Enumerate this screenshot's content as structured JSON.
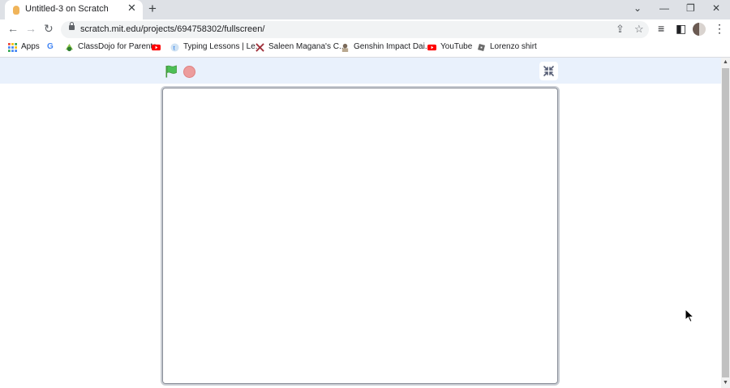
{
  "browser": {
    "tab": {
      "title": "Untitled-3 on Scratch",
      "close_glyph": "✕"
    },
    "new_tab_glyph": "+",
    "window_controls": {
      "dropdown": "⌄",
      "minimize": "—",
      "restore": "❐",
      "close": "✕"
    },
    "nav": {
      "back": "←",
      "forward": "→",
      "reload": "↻"
    },
    "address": {
      "url": "scratch.mit.edu/projects/694758302/fullscreen/"
    },
    "omnibox_icons": {
      "share": "⇪",
      "star": "☆"
    },
    "toolbar_icons": {
      "reading_list": "≡",
      "side_panel": "◧",
      "menu": "⋮"
    },
    "bookmarks": [
      {
        "label": "Apps",
        "icon": "apps-grid-icon"
      },
      {
        "label": "",
        "icon": "google-icon",
        "glyph": "G"
      },
      {
        "label": "ClassDojo for Parents",
        "icon": "classdojo-icon"
      },
      {
        "label": "",
        "icon": "youtube-icon"
      },
      {
        "label": "Typing Lessons | Le...",
        "icon": "typing-icon"
      },
      {
        "label": "Saleen Magana's C...",
        "icon": "x-logo-icon"
      },
      {
        "label": "Genshin Impact Dai...",
        "icon": "genshin-icon"
      },
      {
        "label": "YouTube",
        "icon": "youtube-icon"
      },
      {
        "label": "Lorenzo shirt",
        "icon": "roblox-icon"
      }
    ]
  },
  "scratch": {
    "green_flag_icon": "green-flag-icon",
    "stop_icon": "stop-sign-icon",
    "exit_fullscreen_icon": "exit-fullscreen-icon"
  },
  "colors": {
    "tabstrip": "#dee1e6",
    "stage_header": "#e9f1fc",
    "green_flag": "#4cbf56",
    "stop": "#ec9c9c"
  }
}
